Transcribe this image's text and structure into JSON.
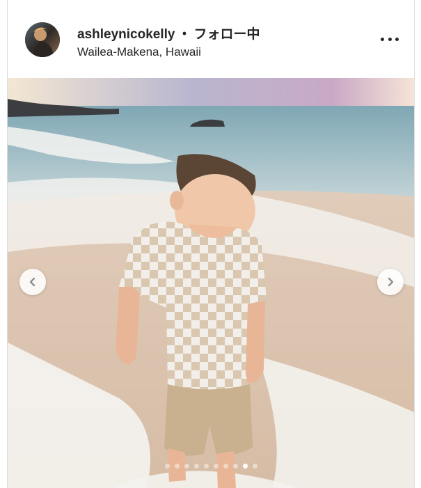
{
  "post": {
    "username": "ashleynicokelly",
    "separator": "・",
    "follow_status": "フォロー中",
    "location": "Wailea-Makena, Hawaii",
    "more_icon": "more-horizontal-icon",
    "carousel": {
      "prev_icon": "chevron-left-icon",
      "next_icon": "chevron-right-icon",
      "slide_count": 10,
      "active_index": 8
    }
  }
}
